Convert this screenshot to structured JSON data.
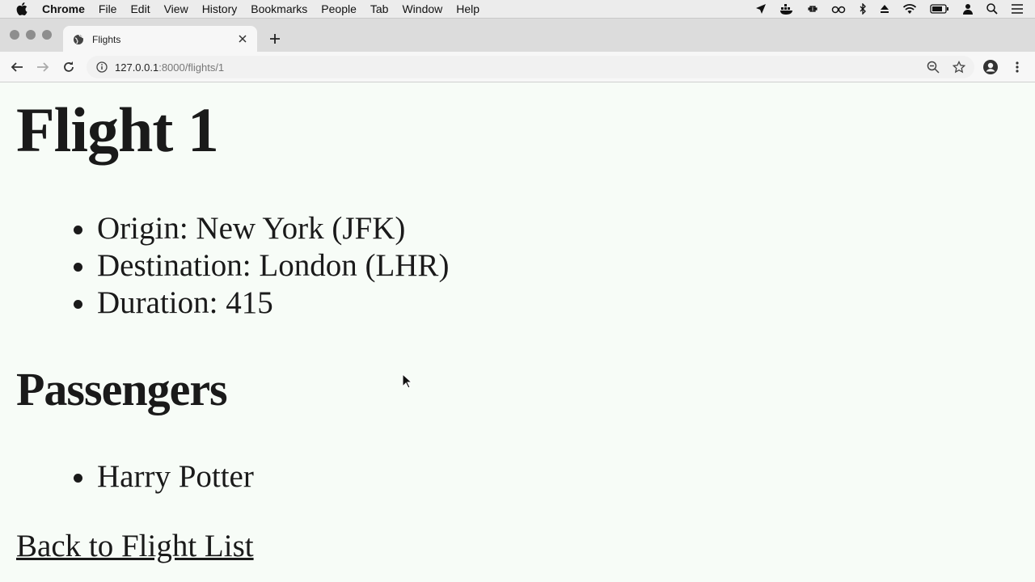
{
  "menubar": {
    "app": "Chrome",
    "items": [
      "File",
      "Edit",
      "View",
      "History",
      "Bookmarks",
      "People",
      "Tab",
      "Window",
      "Help"
    ]
  },
  "tab": {
    "title": "Flights"
  },
  "toolbar": {
    "url_host": "127.0.0.1",
    "url_path": ":8000/flights/1"
  },
  "page": {
    "title": "Flight 1",
    "details": [
      "Origin: New York (JFK)",
      "Destination: London (LHR)",
      "Duration: 415"
    ],
    "passengers_heading": "Passengers",
    "passengers": [
      "Harry Potter"
    ],
    "back_link": "Back to Flight List"
  }
}
